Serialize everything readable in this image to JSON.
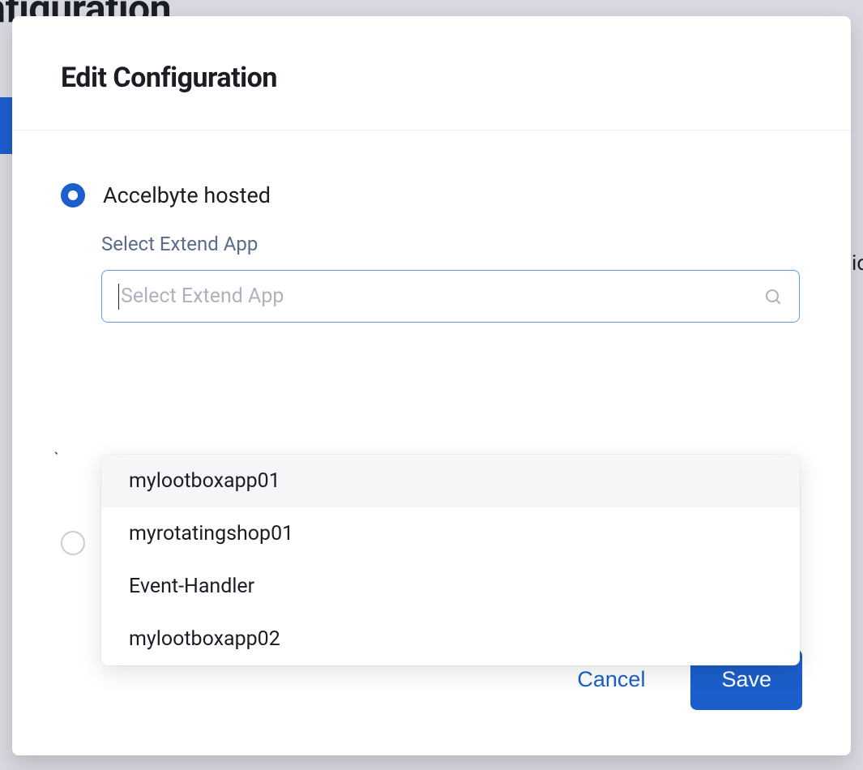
{
  "backdrop": {
    "title_fragment": "nfiguration",
    "right_fragment": "ic"
  },
  "modal": {
    "title": "Edit Configuration"
  },
  "hosting": {
    "option_accelbyte": "Accelbyte hosted"
  },
  "extend_app": {
    "label": "Select Extend App",
    "placeholder": "Select Extend App",
    "options": [
      "mylootboxapp01",
      "myrotatingshop01",
      "Event-Handler",
      "mylootboxapp02"
    ]
  },
  "footer": {
    "cancel": "Cancel",
    "save": "Save"
  }
}
